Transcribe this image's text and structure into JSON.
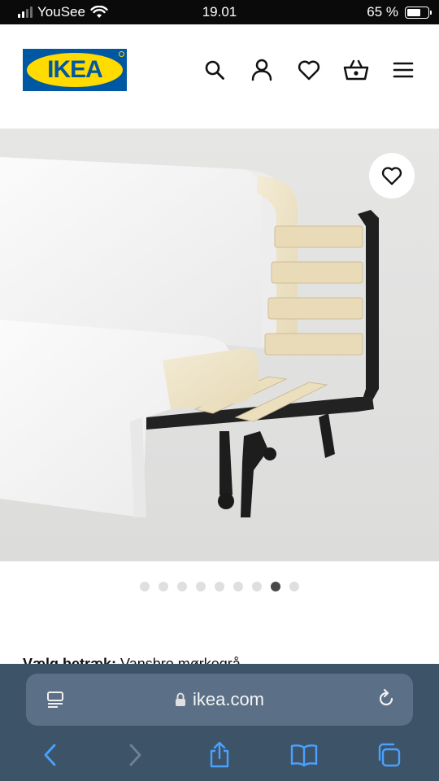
{
  "status_bar": {
    "carrier": "YouSee",
    "time": "19.01",
    "battery_text": "65 %",
    "battery_level": 0.65
  },
  "header": {
    "logo_text": "IKEA",
    "icons": [
      "search-icon",
      "account-icon",
      "favorites-icon",
      "basket-icon",
      "menu-icon"
    ]
  },
  "product_image": {
    "favorite_icon": "heart-icon"
  },
  "carousel": {
    "total_dots": 9,
    "active_index": 7
  },
  "cover": {
    "label": "Vælg betræk:",
    "value": "Vansbro mørkegrå"
  },
  "browser": {
    "url": "ikea.com",
    "icons": [
      "reader-icon",
      "lock-icon",
      "reload-icon",
      "back-icon",
      "forward-icon",
      "share-icon",
      "bookmarks-icon",
      "tabs-icon"
    ]
  },
  "colors": {
    "brand_blue": "#0058a3",
    "brand_yellow": "#ffdb00",
    "browser_bar": "#3d5368",
    "url_field": "#5b7086"
  }
}
